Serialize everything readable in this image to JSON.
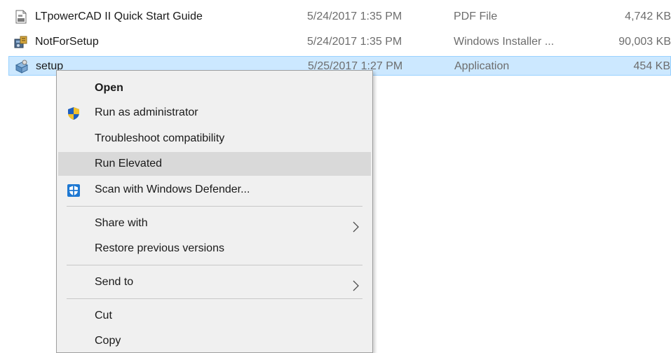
{
  "files": [
    {
      "name": "LTpowerCAD II Quick Start Guide",
      "date": "5/24/2017 1:35 PM",
      "type": "PDF File",
      "size": "4,742 KB",
      "icon": "pdf-file-icon"
    },
    {
      "name": "NotForSetup",
      "date": "5/24/2017 1:35 PM",
      "type": "Windows Installer ...",
      "size": "90,003 KB",
      "icon": "installer-package-icon"
    },
    {
      "name": "setup",
      "date": "5/25/2017 1:27 PM",
      "type": "Application",
      "size": "454 KB",
      "icon": "setup-application-icon"
    }
  ],
  "context_menu": {
    "open": "Open",
    "run_as_admin": "Run as administrator",
    "troubleshoot": "Troubleshoot compatibility",
    "run_elevated": "Run Elevated",
    "scan_defender": "Scan with Windows Defender...",
    "share_with": "Share with",
    "restore_versions": "Restore previous versions",
    "send_to": "Send to",
    "cut": "Cut",
    "copy": "Copy"
  },
  "colors": {
    "selection_bg": "#cce8ff",
    "selection_border": "#99d1ff",
    "menu_bg": "#f0f0f0",
    "menu_highlight": "#d9d9d9",
    "uac_blue": "#1f5fbf",
    "uac_yellow": "#f2c12e",
    "defender_blue": "#1e78d2"
  }
}
